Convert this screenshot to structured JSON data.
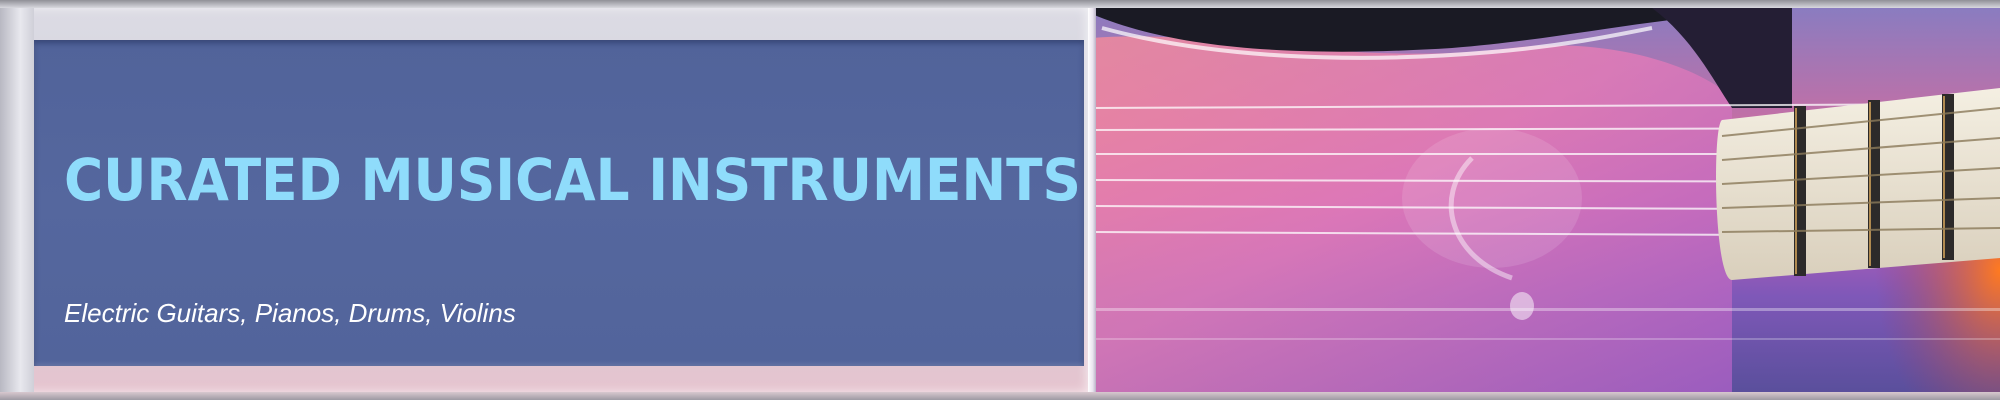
{
  "banner": {
    "title": "CURATED MUSICAL INSTRUMENTS",
    "subtitle": "Electric Guitars, Pianos, Drums, Violins"
  },
  "image": {
    "subject": "electric-guitar-icon"
  },
  "colors": {
    "panel": "#55679e",
    "title": "#8fdcfb",
    "subtitle": "#ffffff",
    "frame": "#cfcfd9",
    "guitar_body": "#c85fb7",
    "fretboard": "#ece6d6"
  }
}
